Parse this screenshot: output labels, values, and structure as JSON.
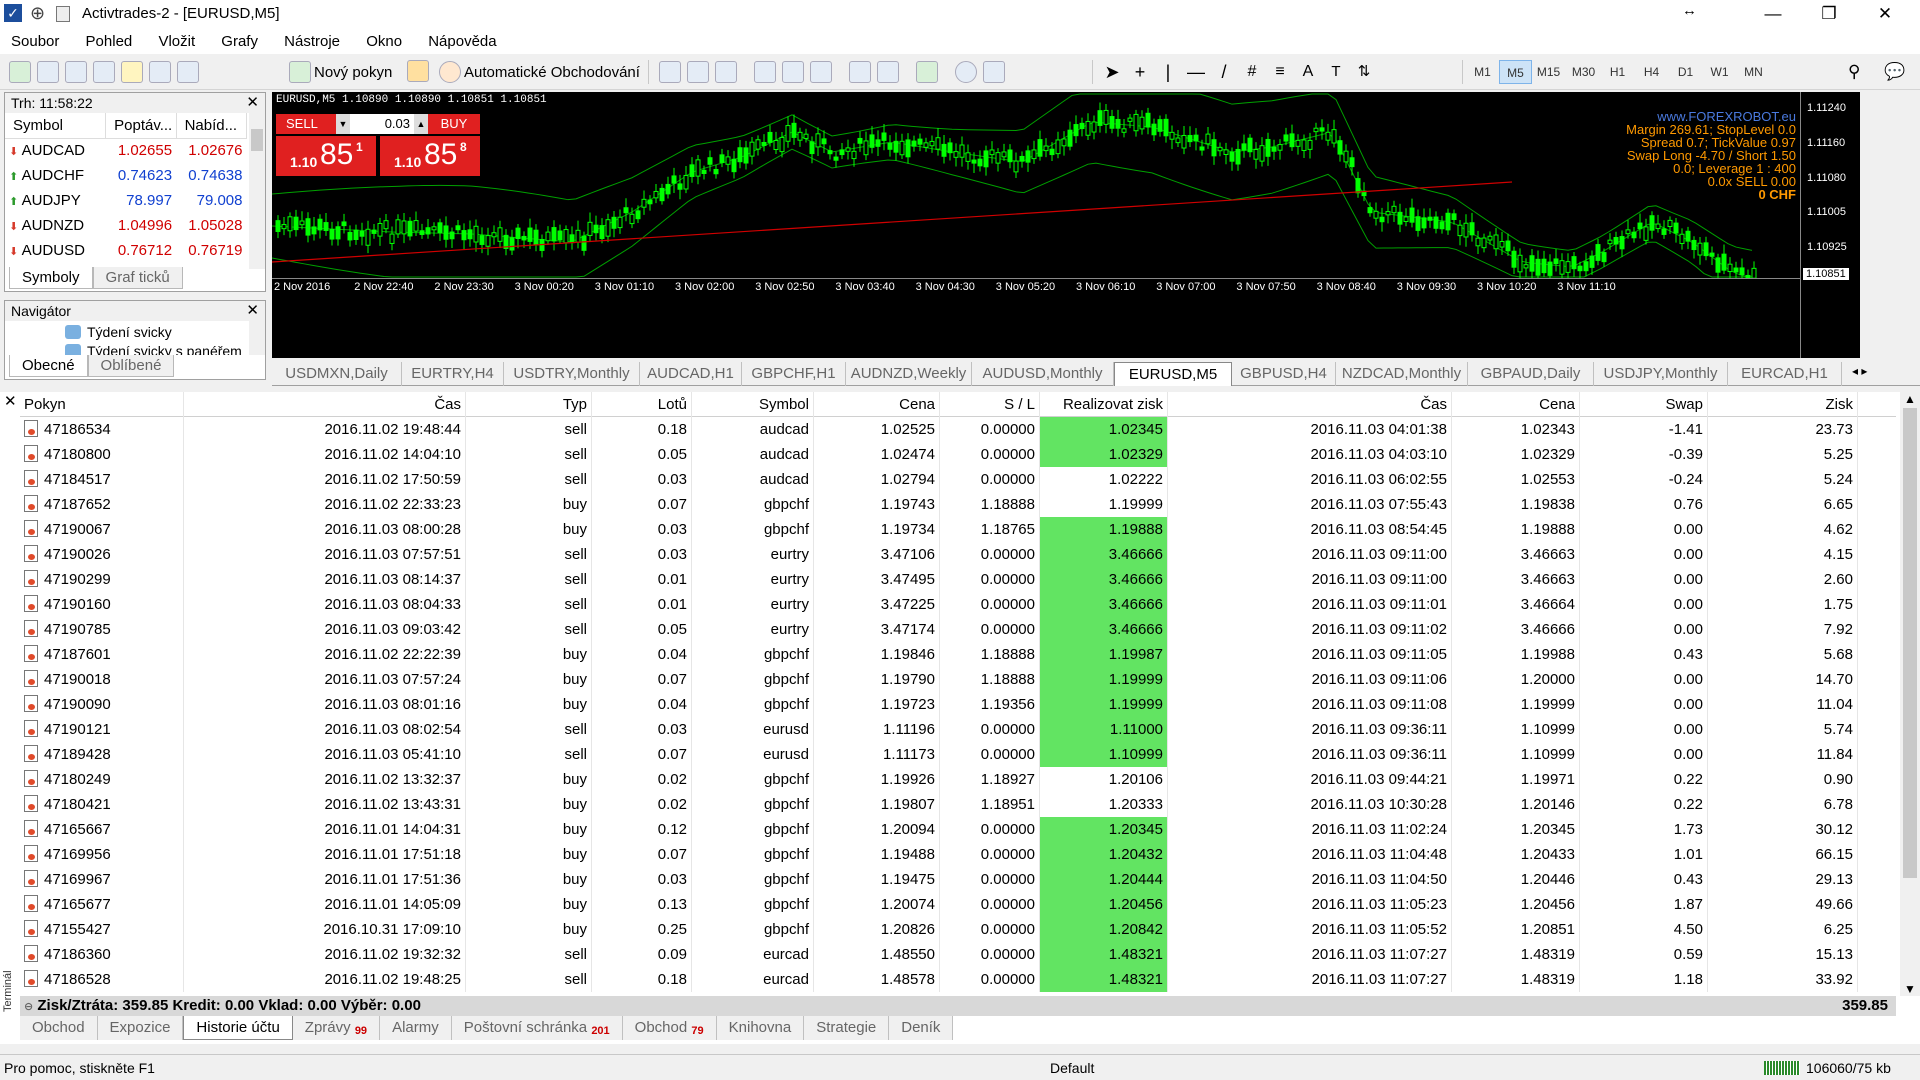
{
  "window": {
    "title": "Activtrades-2 - [EURUSD,M5]"
  },
  "menu": [
    "Soubor",
    "Pohled",
    "Vložit",
    "Grafy",
    "Nástroje",
    "Okno",
    "Nápověda"
  ],
  "toolbar": {
    "new_order": "Nový pokyn",
    "auto_trading": "Automatické Obchodování",
    "timeframes": [
      "M1",
      "M5",
      "M15",
      "M30",
      "H1",
      "H4",
      "D1",
      "W1",
      "MN"
    ],
    "active_tf": "M5"
  },
  "market_watch": {
    "title": "Trh: 11:58:22",
    "cols": [
      "Symbol",
      "Poptáv...",
      "Nabíd..."
    ],
    "rows": [
      {
        "symbol": "AUDCAD",
        "bid": "1.02655",
        "ask": "1.02676",
        "dir": "down"
      },
      {
        "symbol": "AUDCHF",
        "bid": "0.74623",
        "ask": "0.74638",
        "dir": "up"
      },
      {
        "symbol": "AUDJPY",
        "bid": "78.997",
        "ask": "79.008",
        "dir": "up"
      },
      {
        "symbol": "AUDNZD",
        "bid": "1.04996",
        "ask": "1.05028",
        "dir": "down"
      },
      {
        "symbol": "AUDUSD",
        "bid": "0.76712",
        "ask": "0.76719",
        "dir": "down"
      }
    ],
    "tabs": [
      "Symboly",
      "Graf ticků"
    ]
  },
  "navigator": {
    "title": "Navigátor",
    "items": [
      "Týdení svicky",
      "Týdení svicky s panéřem"
    ],
    "tabs": [
      "Obecné",
      "Oblíbené"
    ]
  },
  "chart": {
    "header": "EURUSD,M5  1.10890 1.10890 1.10851 1.10851",
    "sell_label": "SELL",
    "buy_label": "BUY",
    "lot": "0.03",
    "sell_price_small": "1.10",
    "sell_price_big": "85",
    "sell_price_sup": "1",
    "buy_price_small": "1.10",
    "buy_price_big": "85",
    "buy_price_sup": "8",
    "info": [
      "www.FOREXROBOT.eu",
      "Margin 269.61; StopLevel 0.0",
      "Spread 0.7; TickValue 0.97",
      "Swap Long -4.70 / Short 1.50",
      "0.0; Leverage 1 : 400",
      "0.0x SELL 0.00",
      "0 CHF"
    ],
    "y_ticks": [
      "1.11240",
      "1.11160",
      "1.11080",
      "1.11005",
      "1.10925"
    ],
    "current_price": "1.10851",
    "x_ticks": [
      "2 Nov 2016",
      "2 Nov 22:40",
      "2 Nov 23:30",
      "3 Nov 00:20",
      "3 Nov 01:10",
      "3 Nov 02:00",
      "3 Nov 02:50",
      "3 Nov 03:40",
      "3 Nov 04:30",
      "3 Nov 05:20",
      "3 Nov 06:10",
      "3 Nov 07:00",
      "3 Nov 07:50",
      "3 Nov 08:40",
      "3 Nov 09:30",
      "3 Nov 10:20",
      "3 Nov 11:10"
    ],
    "colors": {
      "bg": "#000000",
      "candle": "#00ff00",
      "band": "#00c800",
      "ma": "#d00000",
      "info": "#ff9900"
    }
  },
  "chart_tabs": [
    "USDMXN,Daily",
    "EURTRY,H4",
    "USDTRY,Monthly",
    "AUDCAD,H1",
    "GBPCHF,H1",
    "AUDNZD,Weekly",
    "AUDUSD,Monthly",
    "EURUSD,M5",
    "GBPUSD,H4",
    "NZDCAD,Monthly",
    "GBPAUD,Daily",
    "USDJPY,Monthly",
    "EURCAD,H1"
  ],
  "active_chart_tab": "EURUSD,M5",
  "terminal": {
    "cols": [
      "Pokyn",
      "Čas",
      "Typ",
      "Lotů",
      "Symbol",
      "Cena",
      "S / L",
      "Realizovat zisk",
      "Čas",
      "Cena",
      "Swap",
      "Zisk"
    ],
    "rows": [
      [
        "47186534",
        "2016.11.02 19:48:44",
        "sell",
        "0.18",
        "audcad",
        "1.02525",
        "0.00000",
        "1.02345",
        "2016.11.03 04:01:38",
        "1.02343",
        "-1.41",
        "23.73",
        true
      ],
      [
        "47180800",
        "2016.11.02 14:04:10",
        "sell",
        "0.05",
        "audcad",
        "1.02474",
        "0.00000",
        "1.02329",
        "2016.11.03 04:03:10",
        "1.02329",
        "-0.39",
        "5.25",
        true
      ],
      [
        "47184517",
        "2016.11.02 17:50:59",
        "sell",
        "0.03",
        "audcad",
        "1.02794",
        "0.00000",
        "1.02222",
        "2016.11.03 06:02:55",
        "1.02553",
        "-0.24",
        "5.24",
        false
      ],
      [
        "47187652",
        "2016.11.02 22:33:23",
        "buy",
        "0.07",
        "gbpchf",
        "1.19743",
        "1.18888",
        "1.19999",
        "2016.11.03 07:55:43",
        "1.19838",
        "0.76",
        "6.65",
        false
      ],
      [
        "47190067",
        "2016.11.03 08:00:28",
        "buy",
        "0.03",
        "gbpchf",
        "1.19734",
        "1.18765",
        "1.19888",
        "2016.11.03 08:54:45",
        "1.19888",
        "0.00",
        "4.62",
        true
      ],
      [
        "47190026",
        "2016.11.03 07:57:51",
        "sell",
        "0.03",
        "eurtry",
        "3.47106",
        "0.00000",
        "3.46666",
        "2016.11.03 09:11:00",
        "3.46663",
        "0.00",
        "4.15",
        true
      ],
      [
        "47190299",
        "2016.11.03 08:14:37",
        "sell",
        "0.01",
        "eurtry",
        "3.47495",
        "0.00000",
        "3.46666",
        "2016.11.03 09:11:00",
        "3.46663",
        "0.00",
        "2.60",
        true
      ],
      [
        "47190160",
        "2016.11.03 08:04:33",
        "sell",
        "0.01",
        "eurtry",
        "3.47225",
        "0.00000",
        "3.46666",
        "2016.11.03 09:11:01",
        "3.46664",
        "0.00",
        "1.75",
        true
      ],
      [
        "47190785",
        "2016.11.03 09:03:42",
        "sell",
        "0.05",
        "eurtry",
        "3.47174",
        "0.00000",
        "3.46666",
        "2016.11.03 09:11:02",
        "3.46666",
        "0.00",
        "7.92",
        true
      ],
      [
        "47187601",
        "2016.11.02 22:22:39",
        "buy",
        "0.04",
        "gbpchf",
        "1.19846",
        "1.18888",
        "1.19987",
        "2016.11.03 09:11:05",
        "1.19988",
        "0.43",
        "5.68",
        true
      ],
      [
        "47190018",
        "2016.11.03 07:57:24",
        "buy",
        "0.07",
        "gbpchf",
        "1.19790",
        "1.18888",
        "1.19999",
        "2016.11.03 09:11:06",
        "1.20000",
        "0.00",
        "14.70",
        true
      ],
      [
        "47190090",
        "2016.11.03 08:01:16",
        "buy",
        "0.04",
        "gbpchf",
        "1.19723",
        "1.19356",
        "1.19999",
        "2016.11.03 09:11:08",
        "1.19999",
        "0.00",
        "11.04",
        true
      ],
      [
        "47190121",
        "2016.11.03 08:02:54",
        "sell",
        "0.03",
        "eurusd",
        "1.11196",
        "0.00000",
        "1.11000",
        "2016.11.03 09:36:11",
        "1.10999",
        "0.00",
        "5.74",
        true
      ],
      [
        "47189428",
        "2016.11.03 05:41:10",
        "sell",
        "0.07",
        "eurusd",
        "1.11173",
        "0.00000",
        "1.10999",
        "2016.11.03 09:36:11",
        "1.10999",
        "0.00",
        "11.84",
        true
      ],
      [
        "47180249",
        "2016.11.02 13:32:37",
        "buy",
        "0.02",
        "gbpchf",
        "1.19926",
        "1.18927",
        "1.20106",
        "2016.11.03 09:44:21",
        "1.19971",
        "0.22",
        "0.90",
        false
      ],
      [
        "47180421",
        "2016.11.02 13:43:31",
        "buy",
        "0.02",
        "gbpchf",
        "1.19807",
        "1.18951",
        "1.20333",
        "2016.11.03 10:30:28",
        "1.20146",
        "0.22",
        "6.78",
        false
      ],
      [
        "47165667",
        "2016.11.01 14:04:31",
        "buy",
        "0.12",
        "gbpchf",
        "1.20094",
        "0.00000",
        "1.20345",
        "2016.11.03 11:02:24",
        "1.20345",
        "1.73",
        "30.12",
        true
      ],
      [
        "47169956",
        "2016.11.01 17:51:18",
        "buy",
        "0.07",
        "gbpchf",
        "1.19488",
        "0.00000",
        "1.20432",
        "2016.11.03 11:04:48",
        "1.20433",
        "1.01",
        "66.15",
        true
      ],
      [
        "47169967",
        "2016.11.01 17:51:36",
        "buy",
        "0.03",
        "gbpchf",
        "1.19475",
        "0.00000",
        "1.20444",
        "2016.11.03 11:04:50",
        "1.20446",
        "0.43",
        "29.13",
        true
      ],
      [
        "47165677",
        "2016.11.01 14:05:09",
        "buy",
        "0.13",
        "gbpchf",
        "1.20074",
        "0.00000",
        "1.20456",
        "2016.11.03 11:05:23",
        "1.20456",
        "1.87",
        "49.66",
        true
      ],
      [
        "47155427",
        "2016.10.31 17:09:10",
        "buy",
        "0.25",
        "gbpchf",
        "1.20826",
        "0.00000",
        "1.20842",
        "2016.11.03 11:05:52",
        "1.20851",
        "4.50",
        "6.25",
        true
      ],
      [
        "47186360",
        "2016.11.02 19:32:32",
        "sell",
        "0.09",
        "eurcad",
        "1.48550",
        "0.00000",
        "1.48321",
        "2016.11.03 11:07:27",
        "1.48319",
        "0.59",
        "15.13",
        true
      ],
      [
        "47186528",
        "2016.11.02 19:48:25",
        "sell",
        "0.18",
        "eurcad",
        "1.48578",
        "0.00000",
        "1.48321",
        "2016.11.03 11:07:27",
        "1.48319",
        "1.18",
        "33.92",
        true
      ]
    ],
    "totals": {
      "label": "Zisk/Ztráta: 359.85  Kredit: 0.00  Vklad: 0.00  Výběr: 0.00",
      "sum": "359.85"
    },
    "side_label": "Terminál",
    "tabs": [
      {
        "l": "Obchod"
      },
      {
        "l": "Expozice"
      },
      {
        "l": "Historie účtu"
      },
      {
        "l": "Zprávy",
        "n": "99"
      },
      {
        "l": "Alarmy"
      },
      {
        "l": "Poštovní schránka",
        "n": "201"
      },
      {
        "l": "Obchod",
        "n": "79"
      },
      {
        "l": "Knihovna"
      },
      {
        "l": "Strategie"
      },
      {
        "l": "Deník"
      }
    ],
    "active_tab": "Historie účtu"
  },
  "status": {
    "help": "Pro pomoc, stiskněte F1",
    "profile": "Default",
    "traffic": "106060/75 kb"
  }
}
